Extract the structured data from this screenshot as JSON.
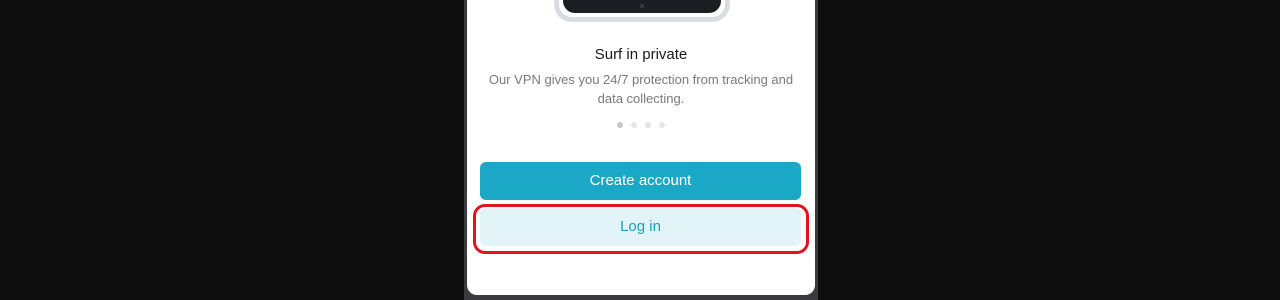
{
  "onboarding": {
    "device_glyph": "×",
    "heading": "Surf in private",
    "description": "Our VPN gives you 24/7 protection from tracking and data collecting.",
    "pager": {
      "total": 4,
      "active_index": 0
    }
  },
  "actions": {
    "create_account_label": "Create account",
    "login_label": "Log in"
  },
  "colors": {
    "accent": "#1aa8c6",
    "accent_light": "#e3f4f8",
    "highlight": "#e0141e"
  }
}
